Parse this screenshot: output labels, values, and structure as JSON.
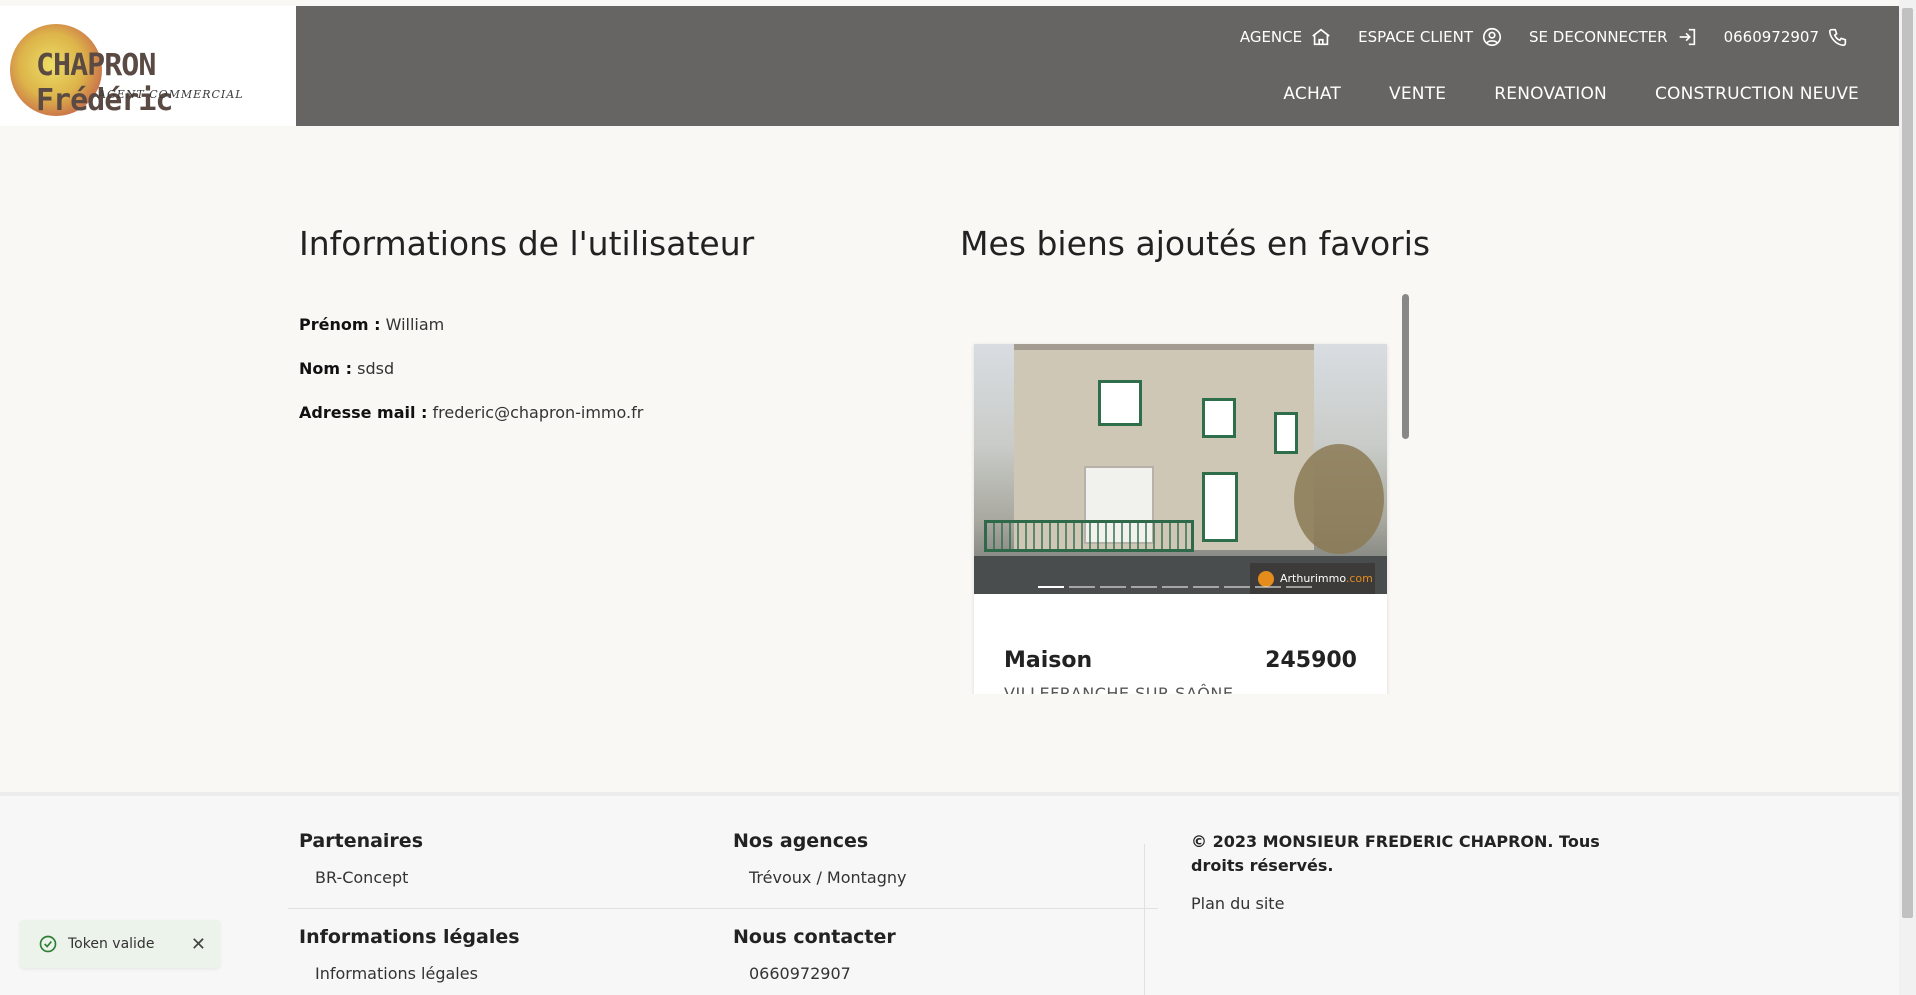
{
  "header": {
    "logo": {
      "name": "CHAPRON Frédéric",
      "subtitle": "AGENT COMMERCIAL",
      "icon": "logo-icon"
    },
    "top_links": [
      {
        "label": "AGENCE",
        "icon": "home-icon"
      },
      {
        "label": "ESPACE CLIENT",
        "icon": "user-circle-icon"
      },
      {
        "label": "SE DECONNECTER",
        "icon": "logout-icon"
      },
      {
        "label": "0660972907",
        "icon": "phone-icon"
      }
    ],
    "nav": [
      "ACHAT",
      "VENTE",
      "RENOVATION",
      "CONSTRUCTION NEUVE"
    ],
    "background": "#666563"
  },
  "user_info": {
    "title": "Informations de l'utilisateur",
    "first_name_label": "Prénom :",
    "first_name": "William",
    "last_name_label": "Nom :",
    "last_name": "sdsd",
    "email_label": "Adresse mail :",
    "email": "frederic@chapron-immo.fr"
  },
  "favorites": {
    "title": "Mes biens ajoutés en favoris",
    "cards": [
      {
        "type": "Maison",
        "price": "245900",
        "city": "VILLEFRANCHE SUR SAÔNE",
        "watermark": "Arthurimmo",
        "watermark_suffix": ".com",
        "photo_dots": 9,
        "active_dot": 0
      }
    ]
  },
  "footer": {
    "partners_title": "Partenaires",
    "partners": [
      "BR-Concept"
    ],
    "agencies_title": "Nos agences",
    "agencies": [
      "Trévoux / Montagny"
    ],
    "legal_title": "Informations légales",
    "legal_links": [
      "Informations légales"
    ],
    "contact_title": "Nous contacter",
    "contact": [
      "0660972907"
    ],
    "copyright": "© 2023 MONSIEUR FREDERIC CHAPRON. Tous droits réservés.",
    "sitemap": "Plan du site"
  },
  "toast": {
    "message": "Token valide",
    "icon": "check-circle-icon",
    "close_icon": "close-icon",
    "color": "#2e7d32"
  }
}
